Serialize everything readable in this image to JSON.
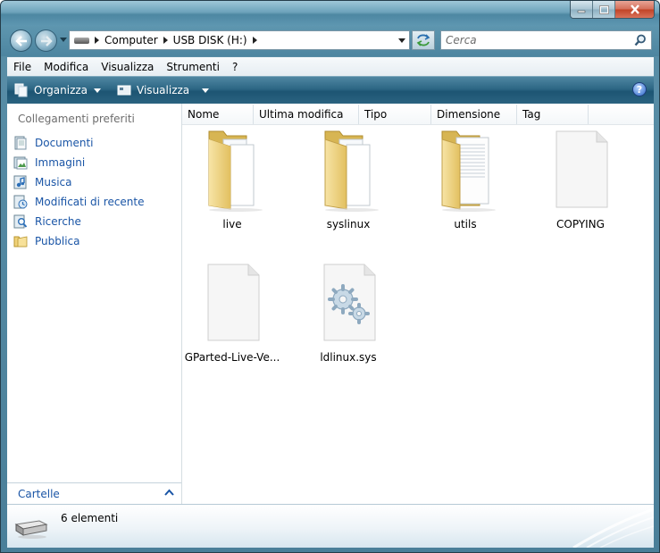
{
  "address": {
    "crumbs": [
      "Computer",
      "USB DISK (H:)"
    ]
  },
  "search": {
    "placeholder": "Cerca"
  },
  "menu": [
    "File",
    "Modifica",
    "Visualizza",
    "Strumenti",
    "?"
  ],
  "commandbar": {
    "organize_label": "Organizza",
    "views_label": "Visualizza",
    "help_label": "?"
  },
  "navpane": {
    "heading": "Collegamenti preferiti",
    "favorites": [
      {
        "label": "Documenti",
        "icon": "documents-icon"
      },
      {
        "label": "Immagini",
        "icon": "pictures-icon"
      },
      {
        "label": "Musica",
        "icon": "music-icon"
      },
      {
        "label": "Modificati di recente",
        "icon": "recent-icon"
      },
      {
        "label": "Ricerche",
        "icon": "searches-icon"
      },
      {
        "label": "Pubblica",
        "icon": "public-folder-icon"
      }
    ],
    "folders_label": "Cartelle"
  },
  "columns": [
    "Nome",
    "Ultima modifica",
    "Tipo",
    "Dimensione",
    "Tag"
  ],
  "items": [
    {
      "name": "live",
      "icon": "folder-icon"
    },
    {
      "name": "syslinux",
      "icon": "folder-icon"
    },
    {
      "name": "utils",
      "icon": "folder-icon"
    },
    {
      "name": "COPYING",
      "icon": "file-icon"
    },
    {
      "name": "GParted-Live-Ve...",
      "icon": "file-icon"
    },
    {
      "name": "ldlinux.sys",
      "icon": "system-file-icon"
    }
  ],
  "status": {
    "count_text": "6 elementi"
  },
  "colors": {
    "link": "#1a55a6",
    "command_bar": "#2d6785",
    "frame": "#4a7f99"
  }
}
